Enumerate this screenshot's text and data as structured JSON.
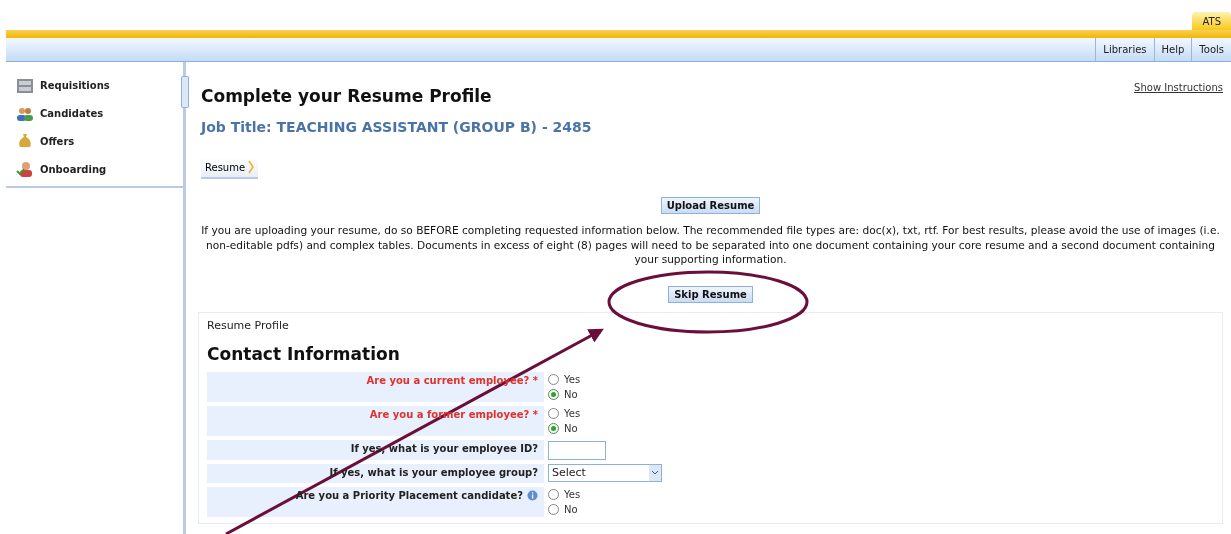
{
  "app_tab": {
    "label": "ATS",
    "selected": true
  },
  "menu": [
    "Libraries",
    "Help",
    "Tools"
  ],
  "sidebar": {
    "items": [
      {
        "label": "Requisitions"
      },
      {
        "label": "Candidates"
      },
      {
        "label": "Offers"
      },
      {
        "label": "Onboarding"
      }
    ]
  },
  "page": {
    "title": "Complete your Resume Profile",
    "job_title": "Job Title: TEACHING ASSISTANT (GROUP B) - 2485",
    "show_instructions": "Show Instructions",
    "step": "Resume",
    "upload_button": "Upload Resume",
    "notice": "If you are uploading your resume, do so BEFORE completing requested information below. The recommended file types are: doc(x), txt, rtf. For best results, please avoid the use of images (i.e. non-editable pdfs) and complex tables. Documents in excess of eight (8) pages will need to be separated into one document containing your core resume and a second document containing your supporting information.",
    "skip_button": "Skip Resume"
  },
  "profile": {
    "header": "Resume Profile",
    "section": "Contact Information",
    "fields": [
      {
        "kind": "radio",
        "label": "Are you a current employee?",
        "required_mark": "*",
        "options": [
          {
            "label": "Yes",
            "selected": false
          },
          {
            "label": "No",
            "selected": true
          }
        ]
      },
      {
        "kind": "radio",
        "label": "Are you a former employee?",
        "required_mark": "*",
        "options": [
          {
            "label": "Yes",
            "selected": false
          },
          {
            "label": "No",
            "selected": true
          }
        ]
      },
      {
        "kind": "text",
        "label": "If yes, what is your employee ID?"
      },
      {
        "kind": "select",
        "label": "If yes, what is your employee group?",
        "value": "Select"
      },
      {
        "kind": "radio",
        "label": "Are you a Priority Placement candidate?",
        "info": true,
        "options": [
          {
            "label": "Yes",
            "selected": false
          },
          {
            "label": "No",
            "selected": false
          }
        ]
      }
    ]
  }
}
